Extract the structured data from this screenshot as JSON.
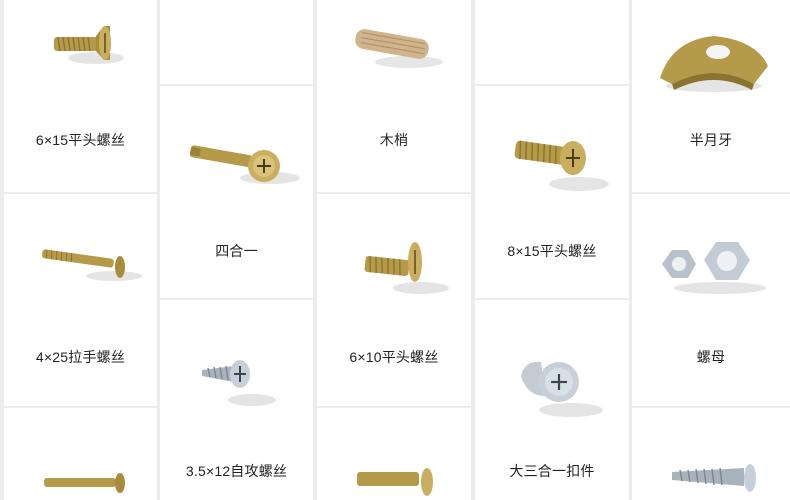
{
  "catalog": {
    "items": [
      {
        "label": "6×15平头螺丝"
      },
      {
        "label": "木梢"
      },
      {
        "label": "半月牙"
      },
      {
        "label": "四合一"
      },
      {
        "label": "8×15平头螺丝"
      },
      {
        "label": "4×25拉手螺丝"
      },
      {
        "label": "6×10平头螺丝"
      },
      {
        "label": "螺母"
      },
      {
        "label": "3.5×12自攻螺丝"
      },
      {
        "label": "大三合一扣件"
      }
    ]
  },
  "colors": {
    "background": "#ececec",
    "card": "#ffffff",
    "brass": "#b59a4a",
    "zinc": "#b9c2cc",
    "wood": "#d2b48c"
  }
}
